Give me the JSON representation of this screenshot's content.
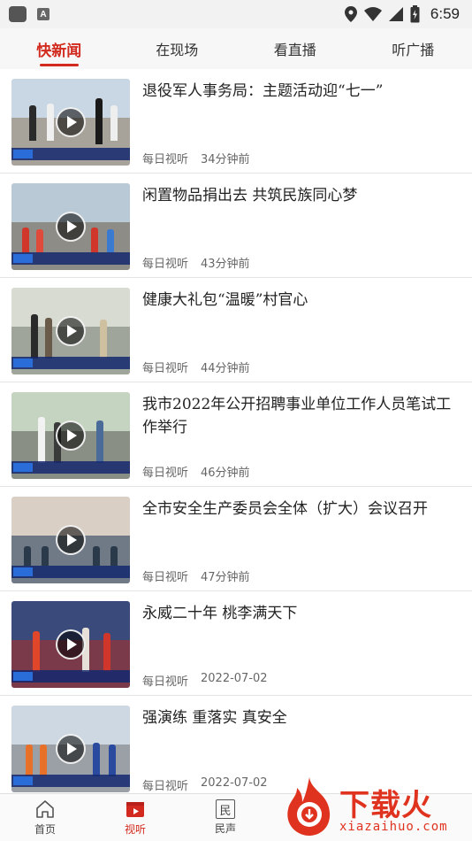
{
  "status_bar": {
    "time": "6:59",
    "icons": [
      "app-icon",
      "a-icon",
      "location-icon",
      "wifi-icon",
      "signal-icon",
      "battery-icon"
    ]
  },
  "tabs": [
    {
      "label": "快新闻",
      "active": true
    },
    {
      "label": "在现场",
      "active": false
    },
    {
      "label": "看直播",
      "active": false
    },
    {
      "label": "听广播",
      "active": false
    }
  ],
  "news": [
    {
      "title": "退役军人事务局：主题活动迎“七一”",
      "source": "每日视听",
      "time": "34分钟前"
    },
    {
      "title": "闲置物品捐出去 共筑民族同心梦",
      "source": "每日视听",
      "time": "43分钟前"
    },
    {
      "title": "健康大礼包“温暖”村官心",
      "source": "每日视听",
      "time": "44分钟前"
    },
    {
      "title": "我市2022年公开招聘事业单位工作人员笔试工作举行",
      "source": "每日视听",
      "time": "46分钟前"
    },
    {
      "title": "全市安全生产委员会全体（扩大）会议召开",
      "source": "每日视听",
      "time": "47分钟前"
    },
    {
      "title": "永威二十年 桃李满天下",
      "source": "每日视听",
      "time": "2022-07-02"
    },
    {
      "title": "强演练 重落实 真安全",
      "source": "每日视听",
      "time": "2022-07-02"
    }
  ],
  "bottom_nav": [
    {
      "label": "首页",
      "icon": "home-icon",
      "active": false
    },
    {
      "label": "视听",
      "icon": "video-icon",
      "active": true
    },
    {
      "label": "民声",
      "icon": "min-icon",
      "active": false,
      "glyph": "民"
    }
  ],
  "watermark": {
    "text": "下载火",
    "url": "xiazaihuo.com"
  },
  "colors": {
    "accent": "#d22a1e",
    "divider": "#e4e4e4"
  }
}
